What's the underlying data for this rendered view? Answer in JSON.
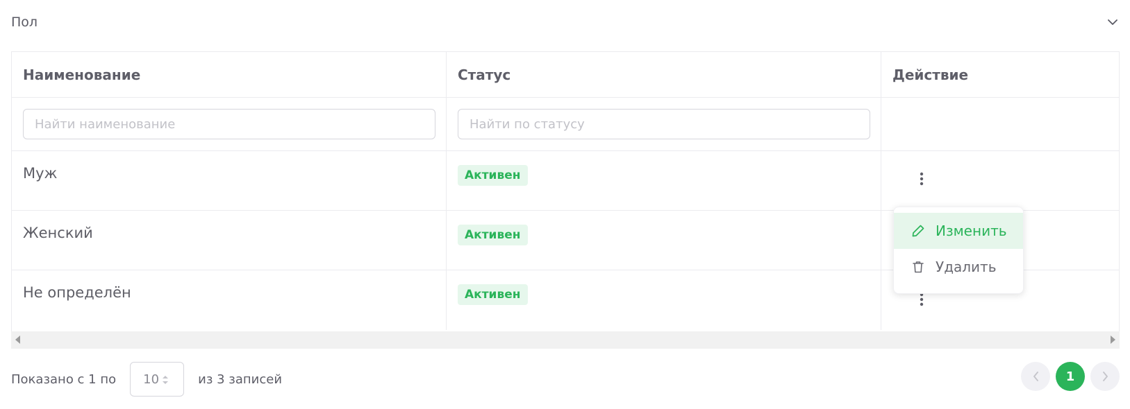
{
  "section": {
    "title": "Пол"
  },
  "table": {
    "columns": [
      "Наименование",
      "Статус",
      "Действие"
    ],
    "filters": {
      "name_placeholder": "Найти наименование",
      "status_placeholder": "Найти по статусу"
    },
    "rows": [
      {
        "name": "Муж",
        "status": "Активен"
      },
      {
        "name": "Женский",
        "status": "Активен"
      },
      {
        "name": "Не определён",
        "status": "Активен"
      }
    ]
  },
  "action_menu": {
    "edit_label": "Изменить",
    "delete_label": "Удалить"
  },
  "footer": {
    "shown_prefix": "Показано с 1 по",
    "page_size": "10",
    "total_suffix": "из 3 записей"
  },
  "pagination": {
    "current_page": "1"
  },
  "colors": {
    "accent": "#2bb45a",
    "badge_bg": "#e6f7ec",
    "border": "#ebebef"
  }
}
